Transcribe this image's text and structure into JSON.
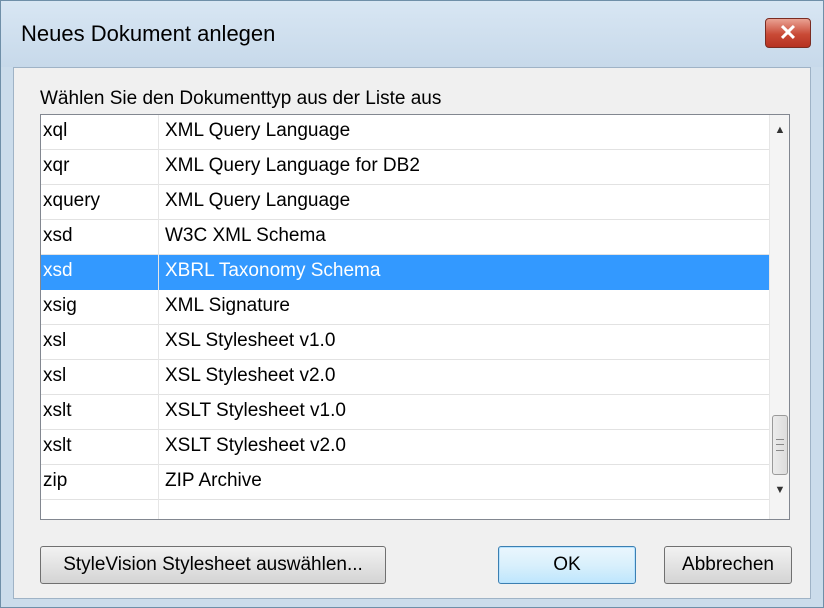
{
  "window": {
    "title": "Neues Dokument anlegen",
    "close_glyph": "✕"
  },
  "prompt": "Wählen Sie den Dokumenttyp aus der Liste aus",
  "list": {
    "rows": [
      {
        "ext": "xql",
        "desc": "XML Query Language"
      },
      {
        "ext": "xqr",
        "desc": "XML Query Language for DB2"
      },
      {
        "ext": "xquery",
        "desc": "XML Query Language"
      },
      {
        "ext": "xsd",
        "desc": "W3C XML Schema"
      },
      {
        "ext": "xsd",
        "desc": "XBRL Taxonomy Schema"
      },
      {
        "ext": "xsig",
        "desc": "XML Signature"
      },
      {
        "ext": "xsl",
        "desc": "XSL Stylesheet v1.0"
      },
      {
        "ext": "xsl",
        "desc": "XSL Stylesheet v2.0"
      },
      {
        "ext": "xslt",
        "desc": "XSLT Stylesheet v1.0"
      },
      {
        "ext": "xslt",
        "desc": "XSLT Stylesheet v2.0"
      },
      {
        "ext": "zip",
        "desc": "ZIP Archive"
      }
    ],
    "selected_index": 4
  },
  "buttons": {
    "stylevision": "StyleVision Stylesheet auswählen...",
    "ok": "OK",
    "cancel": "Abbrechen"
  },
  "colors": {
    "selection": "#3399ff",
    "close_button": "#c94a36"
  },
  "icons": {
    "scroll_up": "▲",
    "scroll_down": "▼"
  }
}
